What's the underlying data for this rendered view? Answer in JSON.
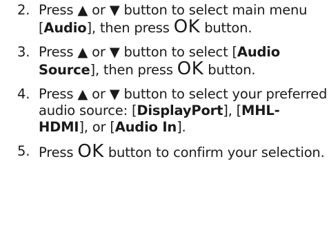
{
  "steps": [
    {
      "number": "2.",
      "press": "Press",
      "up": "▲",
      "or": "or",
      "down": "▼",
      "button_select": "button to select main menu [",
      "bold": "Audio",
      "close_then": "], then press",
      "ok": "OK",
      "tail": "button."
    },
    {
      "number": "3.",
      "press": "Press",
      "up": "▲",
      "or": "or",
      "down": "▼",
      "button_select": "button to select [",
      "bold": "Audio Source",
      "close_then": "], then press",
      "ok": "OK",
      "tail": "button."
    },
    {
      "number": "4.",
      "press": "Press",
      "up": "▲",
      "or": "or",
      "down": "▼",
      "button_select": "button to select your preferred audio source: [",
      "bold1": "DisplayPort",
      "mid1": "], [",
      "bold2": "MHL-HDMI",
      "mid2": "], or [",
      "bold3": "Audio In",
      "end": "]."
    },
    {
      "number": "5.",
      "press": "Press",
      "ok": "OK",
      "tail": "button to confirm your selection."
    }
  ]
}
